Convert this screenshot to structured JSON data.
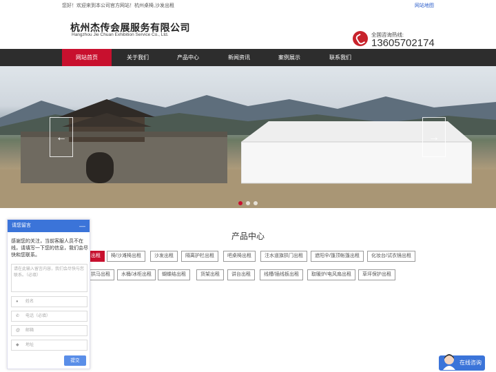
{
  "topbar": {
    "welcome": "您好！欢迎来到本公司官方网站！杭州桌椅,沙发出租",
    "sitemap": "网站地图"
  },
  "header": {
    "company_cn": "杭州杰传会展服务有限公司",
    "company_en": "Hangzhou Jie Chuan Exhibition Service Co., Ltd.",
    "hotline_label": "全国咨询热线:",
    "hotline_number": "13605702174"
  },
  "nav": {
    "items": [
      "网站首页",
      "关于我们",
      "产品中心",
      "新闻资讯",
      "案例展示",
      "联系我们"
    ],
    "active_index": 0
  },
  "banner": {
    "prev_arrow": "←",
    "next_arrow": "→",
    "slide_count": 3,
    "active_slide": 0
  },
  "products": {
    "title": "产品中心",
    "row1": [
      "出租",
      "椅/沙滩椅出租",
      "沙发出租",
      "隔离护栏出租",
      "吧桌椅出租",
      "注水道旗拱门出租",
      "遮阳伞/篷顶帐篷出租",
      "化妆台/试衣镜出租"
    ],
    "row2": [
      "拱马出租",
      "水桶/冰柜出租",
      "蝴蝶结出租",
      "货架出租",
      "讲台出租",
      "线槽/插线板出租",
      "取暖炉/电风扇出租",
      "草坪保护出租"
    ]
  },
  "chat": {
    "title": "请您留言",
    "minimize": "—",
    "intro": "感谢您的关注，当前客服人员不在线，请填写一下您的信息，我们会尽快和您联系。",
    "message_placeholder": "请在此输入留言内容，我们会尽快与您联系。（必填）",
    "fields": [
      "姓名",
      "电话（必填）",
      "邮箱",
      "地址"
    ],
    "submit": "提交"
  },
  "online_service": "在线咨询",
  "colors": {
    "brand_red": "#c8102e",
    "nav_bg": "#2d2d2d",
    "chat_blue": "#3b74d9"
  }
}
